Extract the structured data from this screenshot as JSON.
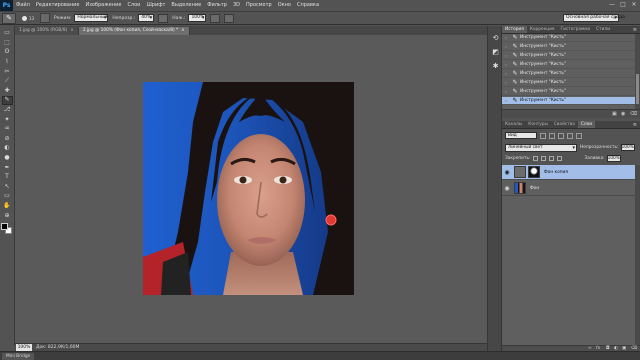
{
  "app": {
    "logo": "Ps"
  },
  "menu": [
    "Файл",
    "Редактирование",
    "Изображение",
    "Слои",
    "Шрифт",
    "Выделение",
    "Фильтр",
    "3D",
    "Просмотр",
    "Окно",
    "Справка"
  ],
  "window_controls": {
    "minimize": "—",
    "maximize": "□",
    "close": "✕"
  },
  "options": {
    "brush_size": "13",
    "mode_label": "Режим:",
    "mode_value": "Нормальный",
    "opacity_label": "Непрозр.:",
    "opacity_value": "40%",
    "flow_label": "Наж.:",
    "flow_value": "100%",
    "workspace": "Основная рабочая среда"
  },
  "tabs": [
    {
      "label": "1.jpg @ 100% (RGB/8)",
      "close": "×"
    },
    {
      "label": "2.jpg @ 100% (Фон копия, Слой-маска/8) *",
      "close": "×"
    }
  ],
  "tools": [
    "▭",
    "⬚",
    "ʘ",
    "⌇",
    "✂",
    "⟋",
    "✚",
    "✎",
    "⎇",
    "✦",
    "♒",
    "⊘",
    "◐",
    "●",
    "✒",
    "T",
    "↖",
    "▭",
    "✋",
    "⊕"
  ],
  "status": {
    "zoom": "100%",
    "doc": "Док: 822,9К/1,60М",
    "mini_bridge": "Mini Bridge"
  },
  "history_panel": {
    "tabs": [
      "История",
      "Коррекция",
      "Гистограмма",
      "Стили"
    ],
    "items": [
      "Инструмент \"Кисть\"",
      "Инструмент \"Кисть\"",
      "Инструмент \"Кисть\"",
      "Инструмент \"Кисть\"",
      "Инструмент \"Кисть\"",
      "Инструмент \"Кисть\"",
      "Инструмент \"Кисть\"",
      "Инструмент \"Кисть\""
    ]
  },
  "layers_panel": {
    "tabs": [
      "Каналы",
      "Контуры",
      "Свойства",
      "Слои"
    ],
    "filter": "Вид",
    "blend_mode": "Линейный свет",
    "opacity_label": "Непрозрачность:",
    "opacity_value": "100%",
    "lock_label": "Закрепить:",
    "fill_label": "Заливка:",
    "fill_value": "100%",
    "layers": [
      {
        "name": "Фон копия",
        "selected": true
      },
      {
        "name": "Фон",
        "selected": false
      }
    ]
  },
  "colors": {
    "foreground": "#000000",
    "background": "#ffffff",
    "selection": "#a2bee8",
    "bg_blue": "#1d5ac2"
  }
}
